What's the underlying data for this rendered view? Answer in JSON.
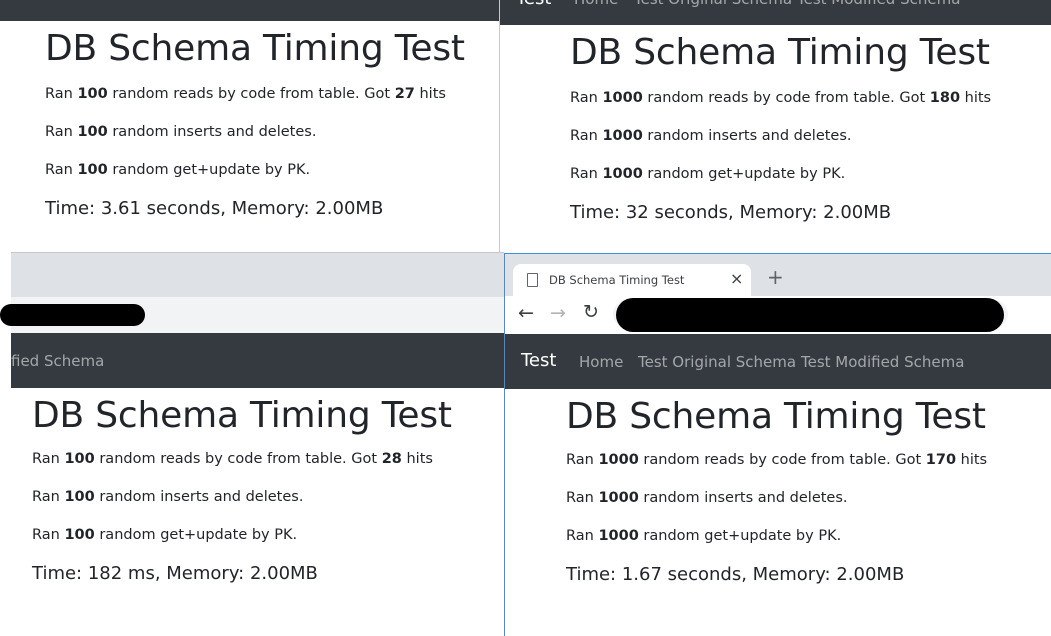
{
  "navbar": {
    "brand": "Test",
    "links": [
      "Home",
      "Test Original Schema",
      "Test Modified Schema"
    ],
    "clipped_link": "fied Schema"
  },
  "browser": {
    "tab_title": "DB Schema Timing Test",
    "close_glyph": "×",
    "new_tab_glyph": "+",
    "back_glyph": "←",
    "forward_glyph": "→",
    "reload_glyph": "↻"
  },
  "panels": {
    "top_left": {
      "title": "DB Schema Timing Test",
      "reads_prefix": "Ran ",
      "reads_count": "100",
      "reads_mid": " random reads by code from table. Got ",
      "reads_hits": "27",
      "reads_suffix": " hits",
      "inserts_prefix": "Ran ",
      "inserts_count": "100",
      "inserts_suffix": " random inserts and deletes.",
      "updates_prefix": "Ran ",
      "updates_count": "100",
      "updates_suffix": " random get+update by PK.",
      "time": "Time: 3.61 seconds, Memory: 2.00MB"
    },
    "top_right": {
      "title": "DB Schema Timing Test",
      "reads_prefix": "Ran ",
      "reads_count": "1000",
      "reads_mid": " random reads by code from table. Got ",
      "reads_hits": "180",
      "reads_suffix": " hits",
      "inserts_prefix": "Ran ",
      "inserts_count": "1000",
      "inserts_suffix": " random inserts and deletes.",
      "updates_prefix": "Ran ",
      "updates_count": "1000",
      "updates_suffix": " random get+update by PK.",
      "time": "Time: 32 seconds, Memory: 2.00MB"
    },
    "bottom_left": {
      "title": "DB Schema Timing Test",
      "reads_prefix": "Ran ",
      "reads_count": "100",
      "reads_mid": " random reads by code from table. Got ",
      "reads_hits": "28",
      "reads_suffix": " hits",
      "inserts_prefix": "Ran ",
      "inserts_count": "100",
      "inserts_suffix": " random inserts and deletes.",
      "updates_prefix": "Ran ",
      "updates_count": "100",
      "updates_suffix": " random get+update by PK.",
      "time": "Time: 182 ms, Memory: 2.00MB"
    },
    "bottom_right": {
      "title": "DB Schema Timing Test",
      "reads_prefix": "Ran ",
      "reads_count": "1000",
      "reads_mid": " random reads by code from table. Got ",
      "reads_hits": "170",
      "reads_suffix": " hits",
      "inserts_prefix": "Ran ",
      "inserts_count": "1000",
      "inserts_suffix": " random inserts and deletes.",
      "updates_prefix": "Ran ",
      "updates_count": "1000",
      "updates_suffix": " random get+update by PK.",
      "time": "Time: 1.67 seconds, Memory: 2.00MB"
    }
  },
  "colors": {
    "navbar_bg": "#343a40",
    "text": "#212529",
    "chrome_bg": "#dee1e6",
    "focus_border": "#3c8fdd"
  }
}
